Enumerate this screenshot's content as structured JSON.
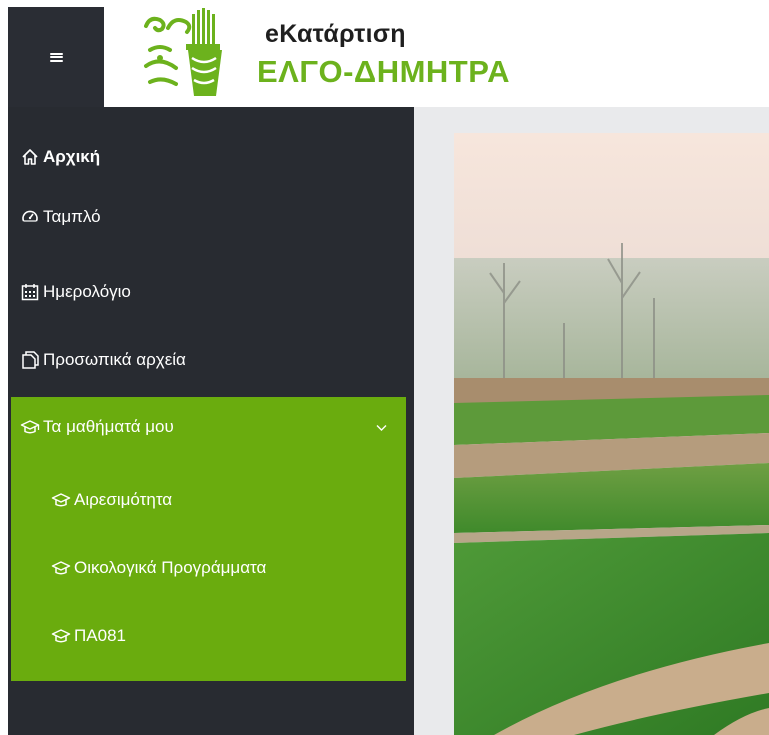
{
  "header": {
    "menu_toggle": "hamburger-icon",
    "logo_title": "eΚατάρτιση",
    "logo_subtitle": "ΕΛΓΟ-ΔΗΜΗΤΡΑ"
  },
  "sidebar": {
    "items": [
      {
        "label": "Αρχική",
        "icon": "home-icon"
      },
      {
        "label": "Ταμπλό",
        "icon": "dashboard-icon"
      },
      {
        "label": "Ημερολόγιο",
        "icon": "calendar-icon"
      },
      {
        "label": "Προσωπικά αρχεία",
        "icon": "files-icon"
      }
    ],
    "courses": {
      "label": "Τα μαθήματά μου",
      "icon": "graduation-cap-icon",
      "expanded": true,
      "items": [
        {
          "label": "Αιρεσιμότητα",
          "icon": "graduation-cap-icon"
        },
        {
          "label": "Οικολογικά Προγράμματα",
          "icon": "graduation-cap-icon"
        },
        {
          "label": "ΠΑ081",
          "icon": "graduation-cap-icon"
        }
      ]
    }
  },
  "colors": {
    "sidebar_bg": "#282b31",
    "accent_green": "#6aac0e",
    "logo_green": "#6cb21d",
    "content_bg": "#e9eaec"
  }
}
